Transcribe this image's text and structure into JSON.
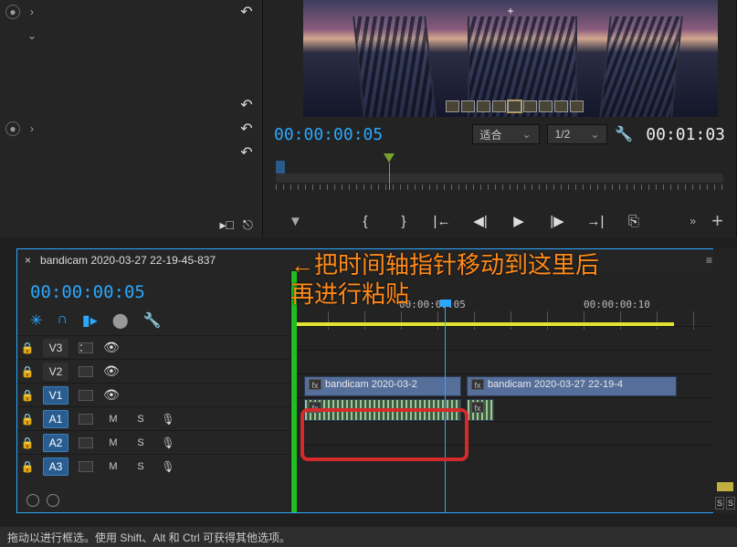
{
  "fx_panel": {
    "undo_rows": 5
  },
  "monitor": {
    "timecode_in": "00:00:00:05",
    "timecode_out": "00:01:03",
    "fit_dropdown": "适合",
    "zoom_dropdown": "1/2"
  },
  "timeline": {
    "sequence_name": "bandicam 2020-03-27 22-19-45-837",
    "timecode": "00:00:00:05",
    "ruler": {
      "label1": "00:00:00:05",
      "label2": "00:00:00:10"
    },
    "tracks": {
      "v3": "V3",
      "v2": "V2",
      "v1": "V1",
      "a1": "A1",
      "a2": "A2",
      "a3": "A3"
    },
    "toggles": {
      "mute": "M",
      "solo": "S"
    },
    "clips": {
      "v1a": "bandicam 2020-03-2",
      "v1b": "bandicam 2020-03-27 22-19-4"
    }
  },
  "annotation": {
    "line1": "←把时间轴指针移动到这里后",
    "line2": "再进行粘贴"
  },
  "meters": {
    "solo": "S"
  },
  "status_bar": "拖动以进行框选。使用 Shift、Alt 和 Ctrl 可获得其他选项。"
}
